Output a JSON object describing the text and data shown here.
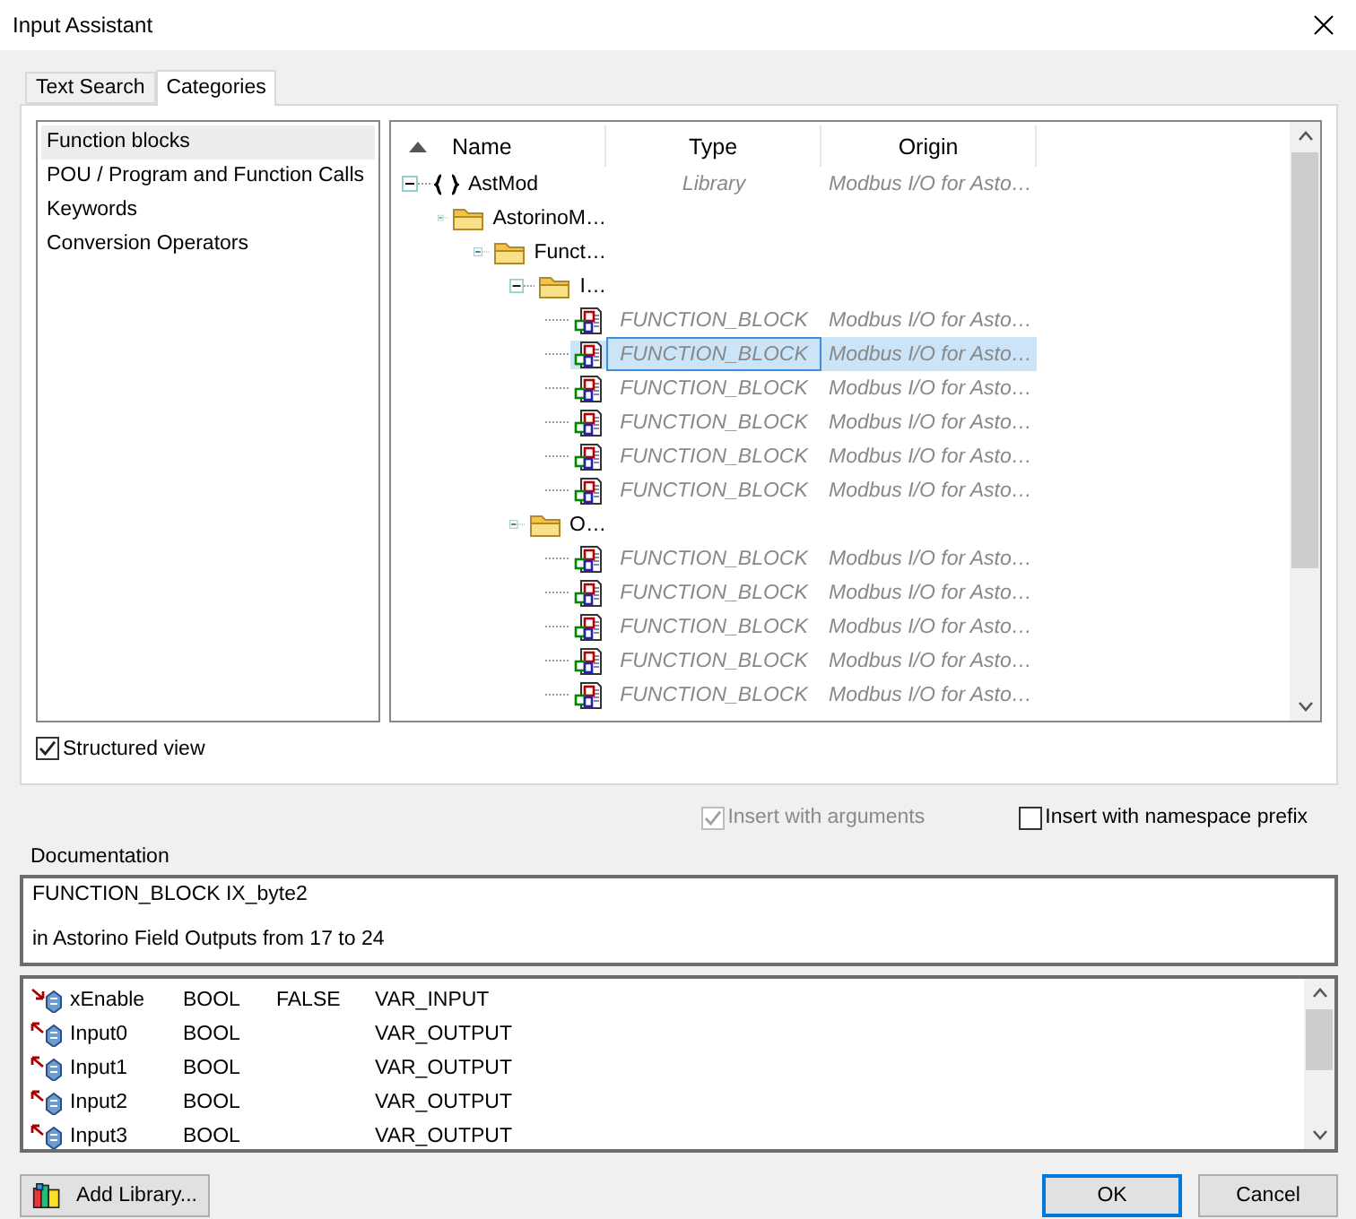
{
  "window": {
    "title": "Input Assistant"
  },
  "tabs": [
    {
      "label": "Text Search",
      "selected": false
    },
    {
      "label": "Categories",
      "selected": true
    }
  ],
  "categories": [
    {
      "label": "Function blocks",
      "selected": true
    },
    {
      "label": "POU / Program and Function Calls",
      "selected": false
    },
    {
      "label": "Keywords",
      "selected": false
    },
    {
      "label": "Conversion Operators",
      "selected": false
    }
  ],
  "tree": {
    "columns": [
      "Name",
      "Type",
      "Origin"
    ],
    "nodes": [
      {
        "kind": "library",
        "name": "AstMod",
        "type": "Library",
        "origin": "Modbus I/O for Asto…",
        "expanded": true,
        "selected": false,
        "children": [
          {
            "kind": "folder",
            "name": "AstorinoM…",
            "expanded": true,
            "selected": false,
            "children": [
              {
                "kind": "folder",
                "name": "Funct…",
                "expanded": true,
                "selected": false,
                "children": [
                  {
                    "kind": "folder",
                    "name": "I…",
                    "expanded": true,
                    "selected": false,
                    "children": [
                      {
                        "kind": "block",
                        "type": "FUNCTION_BLOCK",
                        "origin": "Modbus I/O for Asto…",
                        "selected": false
                      },
                      {
                        "kind": "block",
                        "type": "FUNCTION_BLOCK",
                        "origin": "Modbus I/O for Asto…",
                        "selected": true
                      },
                      {
                        "kind": "block",
                        "type": "FUNCTION_BLOCK",
                        "origin": "Modbus I/O for Asto…",
                        "selected": false
                      },
                      {
                        "kind": "block",
                        "type": "FUNCTION_BLOCK",
                        "origin": "Modbus I/O for Asto…",
                        "selected": false
                      },
                      {
                        "kind": "block",
                        "type": "FUNCTION_BLOCK",
                        "origin": "Modbus I/O for Asto…",
                        "selected": false
                      },
                      {
                        "kind": "block",
                        "type": "FUNCTION_BLOCK",
                        "origin": "Modbus I/O for Asto…",
                        "selected": false
                      }
                    ]
                  },
                  {
                    "kind": "folder",
                    "name": "O…",
                    "expanded": true,
                    "selected": false,
                    "children": [
                      {
                        "kind": "block",
                        "type": "FUNCTION_BLOCK",
                        "origin": "Modbus I/O for Asto…",
                        "selected": false
                      },
                      {
                        "kind": "block",
                        "type": "FUNCTION_BLOCK",
                        "origin": "Modbus I/O for Asto…",
                        "selected": false
                      },
                      {
                        "kind": "block",
                        "type": "FUNCTION_BLOCK",
                        "origin": "Modbus I/O for Asto…",
                        "selected": false
                      },
                      {
                        "kind": "block",
                        "type": "FUNCTION_BLOCK",
                        "origin": "Modbus I/O for Asto…",
                        "selected": false
                      },
                      {
                        "kind": "block",
                        "type": "FUNCTION_BLOCK",
                        "origin": "Modbus I/O for Asto…",
                        "selected": false
                      }
                    ]
                  }
                ]
              }
            ]
          }
        ]
      }
    ]
  },
  "structured_view": {
    "label": "Structured view",
    "checked": true
  },
  "options": [
    {
      "label": "Insert with arguments",
      "checked": true,
      "disabled": true
    },
    {
      "label": "Insert with namespace prefix",
      "checked": false,
      "disabled": false
    }
  ],
  "documentation": {
    "label": "Documentation",
    "lines": [
      "FUNCTION_BLOCK IX_byte2",
      "in Astorino Field Outputs from 17 to 24"
    ]
  },
  "parameters": [
    {
      "kind": "input",
      "name": "xEnable",
      "type": "BOOL",
      "default": "FALSE",
      "scope": "VAR_INPUT"
    },
    {
      "kind": "output",
      "name": "Input0",
      "type": "BOOL",
      "scope": "VAR_OUTPUT"
    },
    {
      "kind": "output",
      "name": "Input1",
      "type": "BOOL",
      "scope": "VAR_OUTPUT"
    },
    {
      "kind": "output",
      "name": "Input2",
      "type": "BOOL",
      "scope": "VAR_OUTPUT"
    },
    {
      "kind": "output",
      "name": "Input3",
      "type": "BOOL",
      "scope": "VAR_OUTPUT"
    }
  ],
  "buttons": {
    "add_library": "Add Library...",
    "ok": "OK",
    "cancel": "Cancel"
  }
}
